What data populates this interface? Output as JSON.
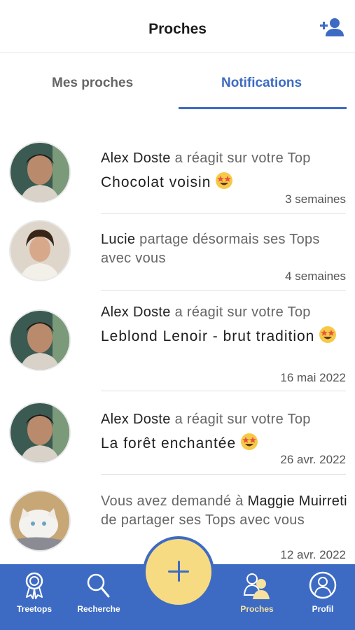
{
  "header": {
    "title": "Proches"
  },
  "tabs": [
    {
      "label": "Mes proches"
    },
    {
      "label": "Notifications"
    }
  ],
  "notifications": [
    {
      "name": "Alex Doste",
      "action": "a réagit sur votre Top",
      "top": "Chocolat voisin",
      "emoji": "star-struck-emoji",
      "time": "3 semaines"
    },
    {
      "name": "Lucie",
      "action": "partage désormais ses Tops avec vous",
      "time": "4 semaines"
    },
    {
      "name": "Alex Doste",
      "action": "a réagit sur votre Top",
      "top": "Leblond Lenoir - brut tradition",
      "emoji": "star-struck-emoji",
      "time": "16 mai 2022"
    },
    {
      "name": "Alex Doste",
      "action": "a réagit sur votre Top",
      "top": "La forêt enchantée",
      "emoji": "star-struck-emoji",
      "time": "26 avr. 2022"
    },
    {
      "prefix": "Vous avez demandé à",
      "name": "Maggie Muirreti",
      "action": "de partager ses Tops avec vous",
      "time": "12 avr. 2022"
    }
  ],
  "tabbar": {
    "items": [
      {
        "label": "Treetops",
        "icon": "award-icon"
      },
      {
        "label": "Recherche",
        "icon": "search-icon"
      },
      {
        "label": "Proches",
        "icon": "friends-icon",
        "active": true
      },
      {
        "label": "Profil",
        "icon": "profile-icon"
      }
    ],
    "fab_icon": "plus-icon"
  },
  "colors": {
    "primary": "#3d6bc3",
    "fab": "#f6db82",
    "active_label": "#f7e2a0"
  }
}
